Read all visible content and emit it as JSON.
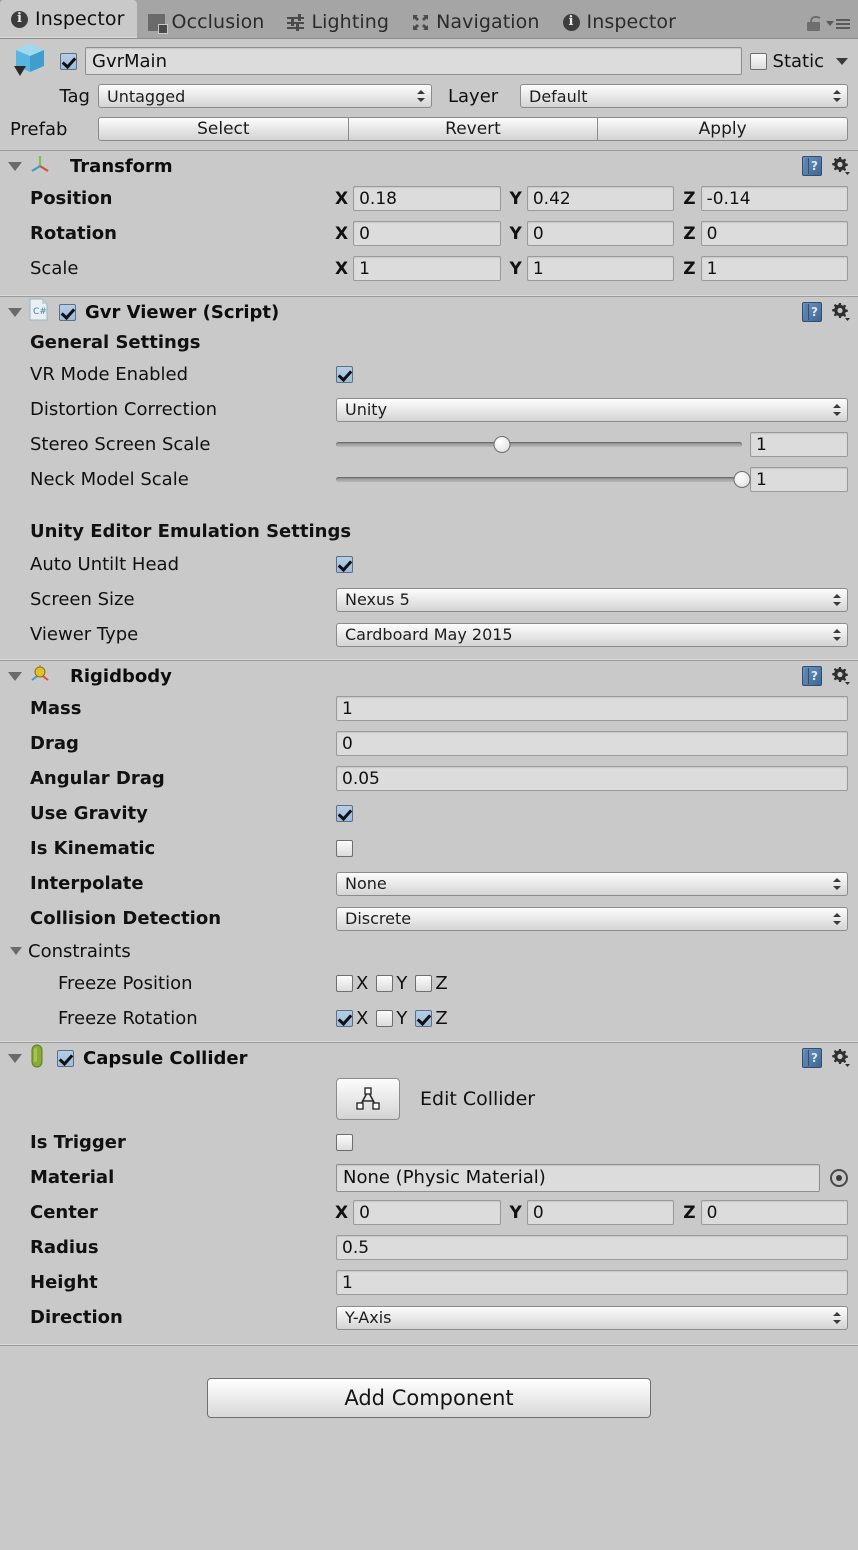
{
  "tabs": [
    {
      "label": "Inspector",
      "icon": "info-icon",
      "active": true
    },
    {
      "label": "Occlusion",
      "icon": "occlusion-icon",
      "active": false
    },
    {
      "label": "Lighting",
      "icon": "lighting-icon",
      "active": false
    },
    {
      "label": "Navigation",
      "icon": "navigation-icon",
      "active": false
    },
    {
      "label": "Inspector",
      "icon": "info-icon",
      "active": false
    }
  ],
  "object_header": {
    "enabled": true,
    "name": "GvrMain",
    "static_label": "Static",
    "static_checked": false,
    "tag_label": "Tag",
    "tag_value": "Untagged",
    "layer_label": "Layer",
    "layer_value": "Default",
    "prefab_label": "Prefab",
    "prefab_buttons": [
      "Select",
      "Revert",
      "Apply"
    ]
  },
  "transform": {
    "title": "Transform",
    "rows": [
      {
        "label": "Position",
        "x": "0.18",
        "y": "0.42",
        "z": "-0.14"
      },
      {
        "label": "Rotation",
        "x": "0",
        "y": "0",
        "z": "0"
      },
      {
        "label": "Scale",
        "x": "1",
        "y": "1",
        "z": "1"
      }
    ],
    "axes": [
      "X",
      "Y",
      "Z"
    ]
  },
  "gvr_viewer": {
    "title": "Gvr Viewer (Script)",
    "enabled": true,
    "general_heading": "General Settings",
    "vr_mode_label": "VR Mode Enabled",
    "vr_mode_checked": true,
    "distortion_label": "Distortion Correction",
    "distortion_value": "Unity",
    "stereo_label": "Stereo Screen Scale",
    "stereo_value": "1",
    "stereo_percent": 41,
    "neck_label": "Neck Model Scale",
    "neck_value": "1",
    "neck_percent": 100,
    "emulation_heading": "Unity Editor Emulation Settings",
    "auto_untilt_label": "Auto Untilt Head",
    "auto_untilt_checked": true,
    "screen_size_label": "Screen Size",
    "screen_size_value": "Nexus 5",
    "viewer_type_label": "Viewer Type",
    "viewer_type_value": "Cardboard May 2015"
  },
  "rigidbody": {
    "title": "Rigidbody",
    "mass_label": "Mass",
    "mass_value": "1",
    "drag_label": "Drag",
    "drag_value": "0",
    "angular_drag_label": "Angular Drag",
    "angular_drag_value": "0.05",
    "use_gravity_label": "Use Gravity",
    "use_gravity_checked": true,
    "is_kinematic_label": "Is Kinematic",
    "is_kinematic_checked": false,
    "interpolate_label": "Interpolate",
    "interpolate_value": "None",
    "collision_label": "Collision Detection",
    "collision_value": "Discrete",
    "constraints_label": "Constraints",
    "freeze_position_label": "Freeze Position",
    "freeze_position": [
      {
        "axis": "X",
        "checked": false
      },
      {
        "axis": "Y",
        "checked": false
      },
      {
        "axis": "Z",
        "checked": false
      }
    ],
    "freeze_rotation_label": "Freeze Rotation",
    "freeze_rotation": [
      {
        "axis": "X",
        "checked": true
      },
      {
        "axis": "Y",
        "checked": false
      },
      {
        "axis": "Z",
        "checked": true
      }
    ]
  },
  "capsule_collider": {
    "title": "Capsule Collider",
    "enabled": true,
    "edit_collider_label": "Edit Collider",
    "is_trigger_label": "Is Trigger",
    "is_trigger_checked": false,
    "material_label": "Material",
    "material_value": "None (Physic Material)",
    "center_label": "Center",
    "center": {
      "x": "0",
      "y": "0",
      "z": "0"
    },
    "radius_label": "Radius",
    "radius_value": "0.5",
    "height_label": "Height",
    "height_value": "1",
    "direction_label": "Direction",
    "direction_value": "Y-Axis",
    "axes": [
      "X",
      "Y",
      "Z"
    ]
  },
  "footer": {
    "add_component_label": "Add Component"
  },
  "colors": {
    "panel_bg": "#c9c9c9",
    "tabbar_bg": "#a5a5a5",
    "field_bg": "#dcdcdc",
    "checkbox_on": "#a8c4de",
    "accent_blue": "#3d6693"
  }
}
